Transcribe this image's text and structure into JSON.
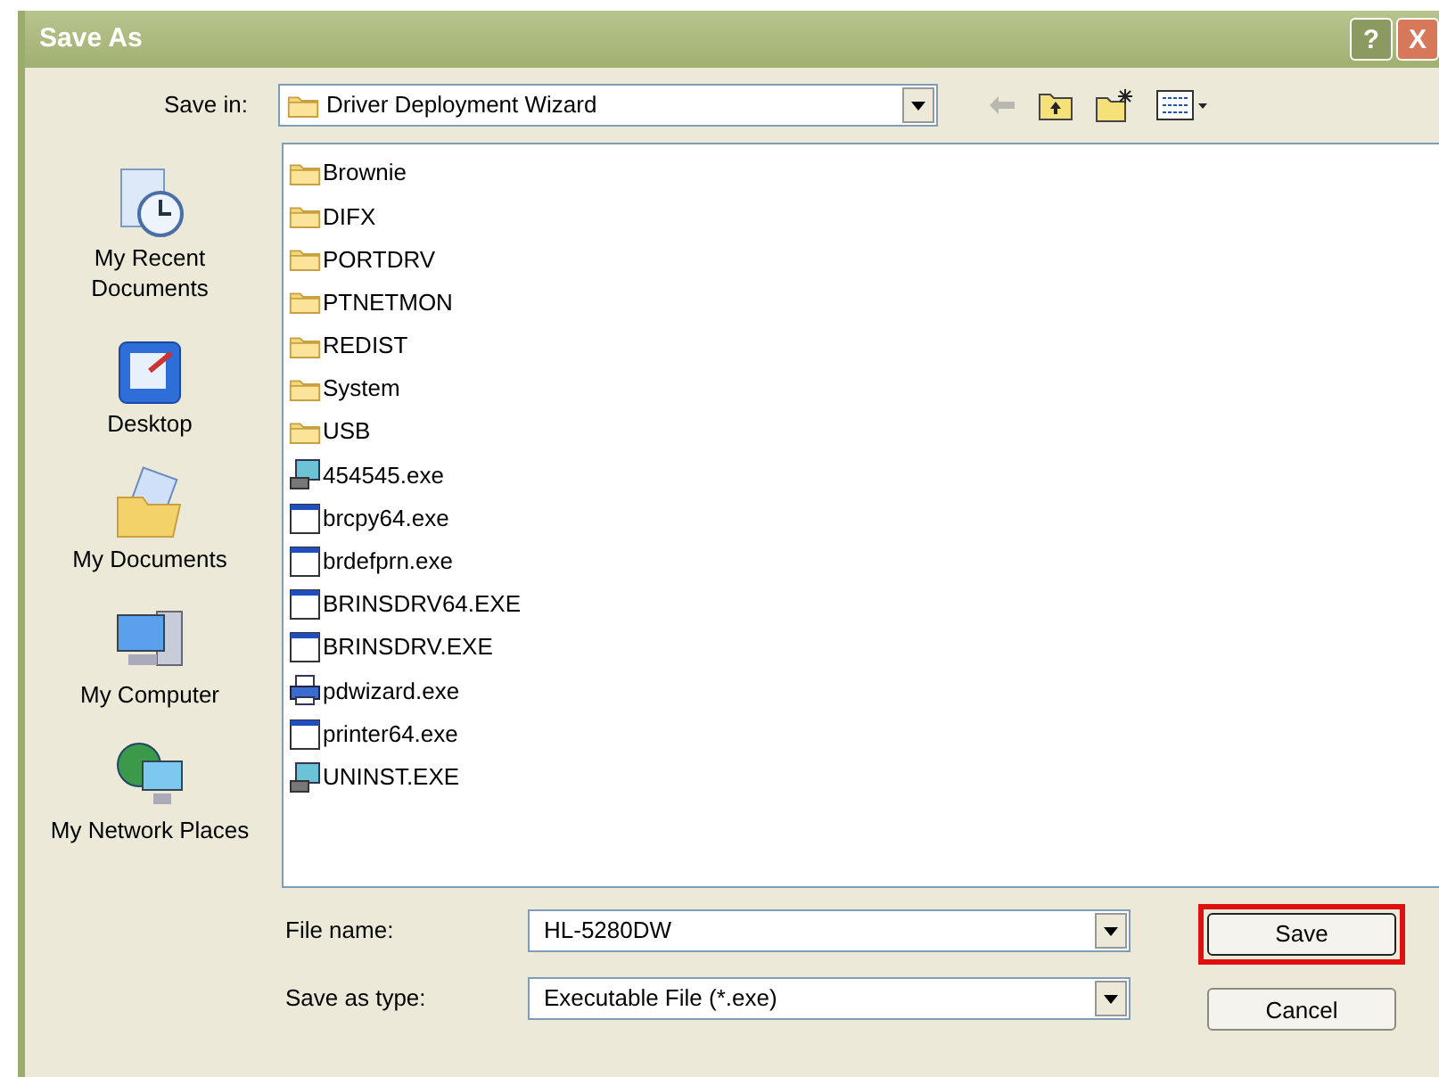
{
  "window": {
    "title": "Save As",
    "buttons": [
      {
        "kind": "help",
        "label": "?"
      },
      {
        "kind": "close",
        "label": "X"
      }
    ]
  },
  "save_in": {
    "label": "Save in:",
    "value": "Driver Deployment Wizard"
  },
  "places": [
    {
      "kind": "recent",
      "label": "My Recent Documents"
    },
    {
      "kind": "desktop",
      "label": "Desktop"
    },
    {
      "kind": "documents",
      "label": "My Documents"
    },
    {
      "kind": "computer",
      "label": "My Computer"
    },
    {
      "kind": "network",
      "label": "My Network Places"
    }
  ],
  "files": [
    {
      "kind": "folder",
      "name": "Brownie"
    },
    {
      "kind": "folder",
      "name": "DIFX"
    },
    {
      "kind": "folder",
      "name": "PORTDRV"
    },
    {
      "kind": "folder",
      "name": "PTNETMON"
    },
    {
      "kind": "folder",
      "name": "REDIST"
    },
    {
      "kind": "folder",
      "name": "System"
    },
    {
      "kind": "folder",
      "name": "USB"
    },
    {
      "kind": "setup",
      "name": "454545.exe"
    },
    {
      "kind": "exe",
      "name": "brcpy64.exe"
    },
    {
      "kind": "exe",
      "name": "brdefprn.exe"
    },
    {
      "kind": "exe",
      "name": "BRINSDRV64.EXE"
    },
    {
      "kind": "exe",
      "name": "BRINSDRV.EXE"
    },
    {
      "kind": "wizard",
      "name": "pdwizard.exe"
    },
    {
      "kind": "exe",
      "name": "printer64.exe"
    },
    {
      "kind": "setup",
      "name": "UNINST.EXE"
    }
  ],
  "file_name": {
    "label": "File name:",
    "value": "HL-5280DW"
  },
  "save_as_type": {
    "label": "Save as type:",
    "value": "Executable File (*.exe)"
  },
  "actions": [
    {
      "label": "Save",
      "highlighted": true
    },
    {
      "label": "Cancel",
      "highlighted": false
    }
  ]
}
